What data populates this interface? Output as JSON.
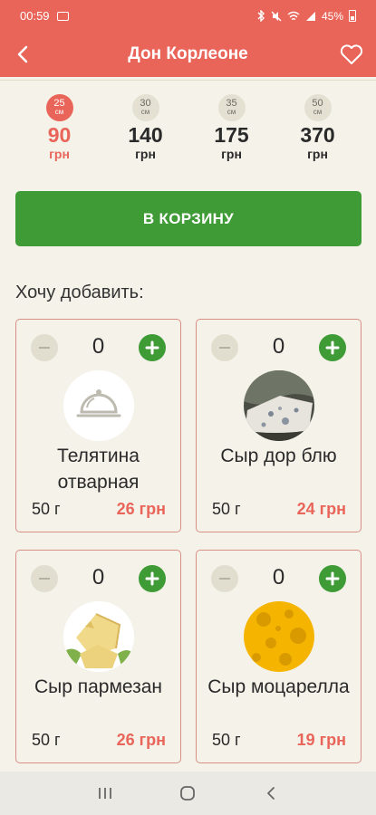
{
  "status": {
    "time": "00:59",
    "battery": "45%"
  },
  "header": {
    "title": "Дон Корлеоне"
  },
  "sizes": [
    {
      "size": "25",
      "unit": "см",
      "price": "90",
      "currency": "грн",
      "selected": true
    },
    {
      "size": "30",
      "unit": "см",
      "price": "140",
      "currency": "грн",
      "selected": false
    },
    {
      "size": "35",
      "unit": "см",
      "price": "175",
      "currency": "грн",
      "selected": false
    },
    {
      "size": "50",
      "unit": "см",
      "price": "370",
      "currency": "грн",
      "selected": false
    }
  ],
  "cart_button": "В КОРЗИНУ",
  "add_title": "Хочу добавить:",
  "toppings": [
    {
      "qty": "0",
      "name": "Телятина отварная",
      "weight": "50 г",
      "price": "26 грн",
      "image": "cloche-icon"
    },
    {
      "qty": "0",
      "name": "Сыр дор блю",
      "weight": "50 г",
      "price": "24 грн",
      "image": "blue-cheese-photo"
    },
    {
      "qty": "0",
      "name": "Сыр пармезан",
      "weight": "50 г",
      "price": "26 грн",
      "image": "parmesan-photo"
    },
    {
      "qty": "0",
      "name": "Сыр моцарелла",
      "weight": "50 г",
      "price": "19 грн",
      "image": "swiss-cheese-photo"
    }
  ],
  "colors": {
    "primary": "#e9655a",
    "accent_green": "#3f9b35",
    "background": "#f4f2e9"
  }
}
